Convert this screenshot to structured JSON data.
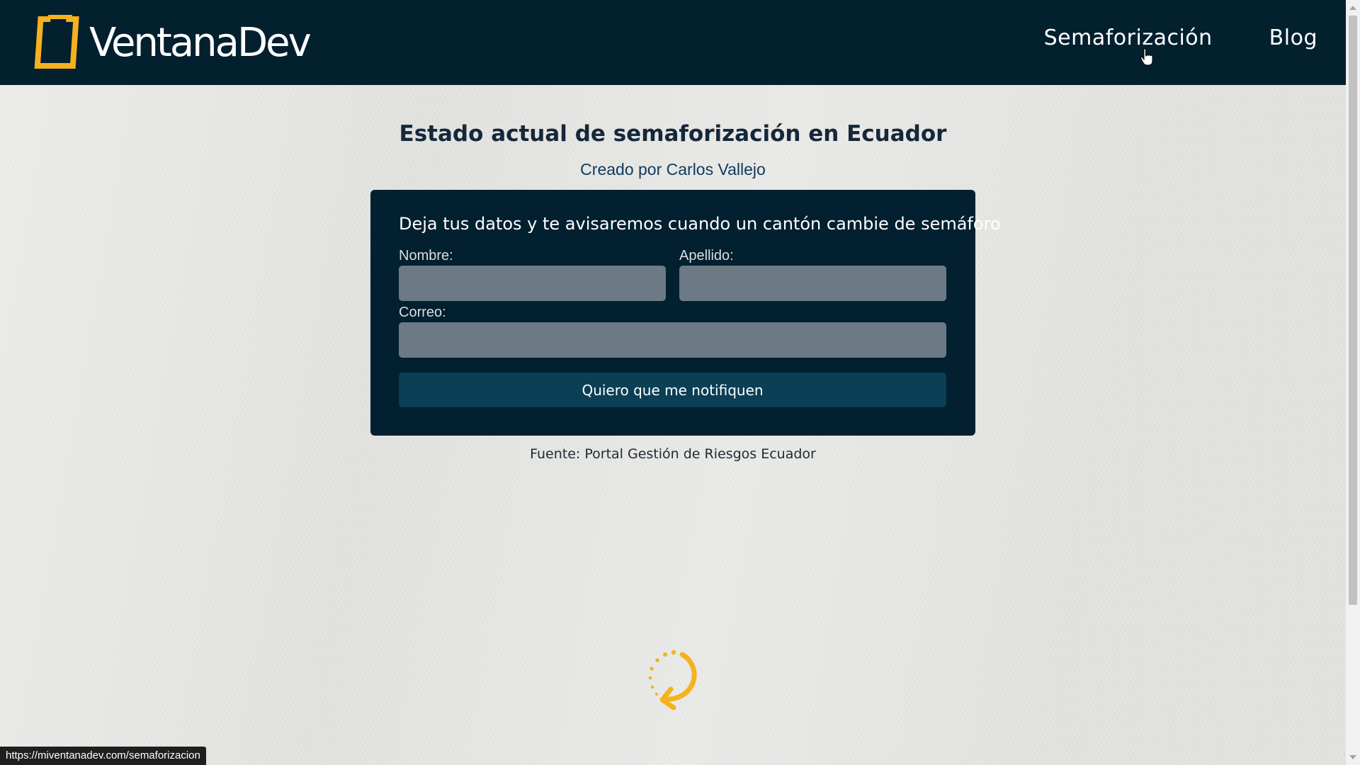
{
  "header": {
    "logo_text": "VentanaDev",
    "nav": [
      {
        "label": "Semaforización"
      },
      {
        "label": "Blog"
      }
    ]
  },
  "main": {
    "title": "Estado actual de semaforización en Ecuador",
    "author": "Creado por Carlos Vallejo",
    "form": {
      "heading": "Deja tus datos y te avisaremos cuando un cantón cambie de semáforo",
      "nombre_label": "Nombre:",
      "nombre_value": "",
      "apellido_label": "Apellido:",
      "apellido_value": "",
      "correo_label": "Correo:",
      "correo_value": "",
      "submit_label": "Quiero que me notifiquen"
    },
    "source": "Fuente: Portal Gestión de Riesgos Ecuador"
  },
  "statusbar": {
    "url": "https://miventanadev.com/semaforizacion"
  },
  "icons": {
    "logo": "window-bracket-logo-icon",
    "loader": "loading-spinner-icon",
    "cursor": "hand-pointer-icon"
  },
  "colors": {
    "header_bg": "#03202f",
    "accent_yellow": "#f5b21e",
    "card_bg": "#022030",
    "input_bg": "#6b7a84",
    "button_bg": "#0a3f55",
    "page_bg": "#e2e2df"
  }
}
